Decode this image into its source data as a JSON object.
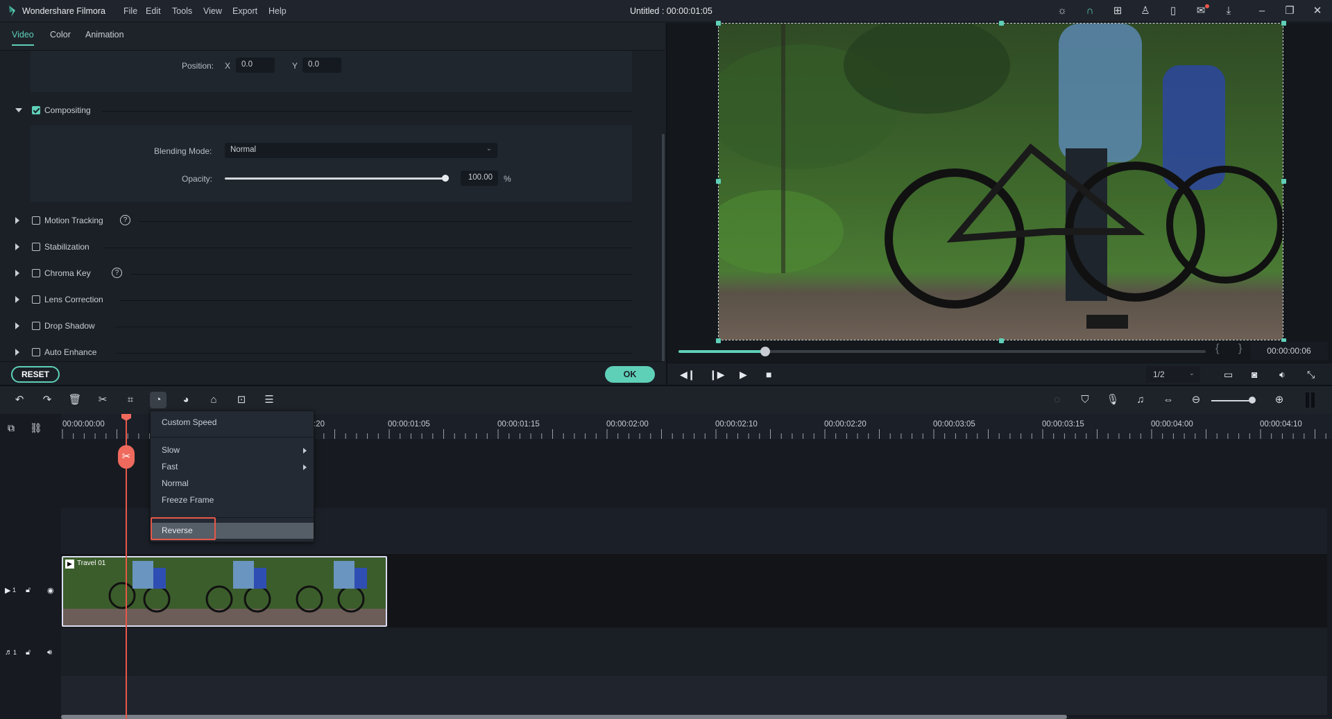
{
  "window": {
    "app_name": "Wondershare Filmora",
    "document_title": "Untitled : 00:00:01:05",
    "menu": [
      "File",
      "Edit",
      "Tools",
      "View",
      "Export",
      "Help"
    ],
    "title_icons": [
      "lightbulb-icon",
      "headset-icon",
      "gift-icon",
      "account-icon",
      "save-icon",
      "mail-icon",
      "download-icon",
      "minimize-icon",
      "restore-icon",
      "close-icon"
    ]
  },
  "panel": {
    "tabs": [
      {
        "label": "Video",
        "active": true
      },
      {
        "label": "Color",
        "active": false
      },
      {
        "label": "Animation",
        "active": false
      }
    ],
    "position": {
      "label": "Position:",
      "x_label": "X",
      "x_value": "0.0",
      "y_label": "Y",
      "y_value": "0.0"
    },
    "compositing": {
      "label": "Compositing",
      "checked": true,
      "expanded": true,
      "blending_label": "Blending Mode:",
      "blending_value": "Normal",
      "opacity_label": "Opacity:",
      "opacity_value": "100.00",
      "opacity_unit": "%",
      "opacity_fraction": 1.0
    },
    "sections": [
      {
        "label": "Motion Tracking",
        "checked": false,
        "help": true
      },
      {
        "label": "Stabilization",
        "checked": false,
        "help": false
      },
      {
        "label": "Chroma Key",
        "checked": false,
        "help": true
      },
      {
        "label": "Lens Correction",
        "checked": false,
        "help": false
      },
      {
        "label": "Drop Shadow",
        "checked": false,
        "help": false
      },
      {
        "label": "Auto Enhance",
        "checked": false,
        "help": false
      }
    ],
    "reset_label": "RESET",
    "ok_label": "OK"
  },
  "preview": {
    "progress_fraction": 0.165,
    "mark_in": "{",
    "mark_out": "}",
    "timecode": "00:00:00:06",
    "quality": "1/2"
  },
  "timeline": {
    "ruler_labels": [
      "00:00:00:00",
      ":20",
      "00:00:01:05",
      "00:00:01:15",
      "00:00:02:00",
      "00:00:02:10",
      "00:00:02:20",
      "00:00:03:05",
      "00:00:03:15",
      "00:00:04:00",
      "00:00:04:10"
    ],
    "video_track": {
      "number": "1",
      "clip_name": "Travel 01"
    },
    "audio_track": {
      "number": "1"
    },
    "zoom_fraction": 0.9
  },
  "speed_menu": {
    "items": [
      {
        "label": "Custom Speed",
        "submenu": false
      },
      {
        "label": "Slow",
        "submenu": true
      },
      {
        "label": "Fast",
        "submenu": true
      },
      {
        "label": "Normal",
        "submenu": false
      },
      {
        "label": "Freeze Frame",
        "submenu": false
      },
      {
        "label": "Reverse",
        "submenu": false,
        "highlighted": true
      }
    ]
  },
  "colors": {
    "accent": "#5fd0b8",
    "playhead": "#e8574a",
    "background": "#1b2027"
  }
}
